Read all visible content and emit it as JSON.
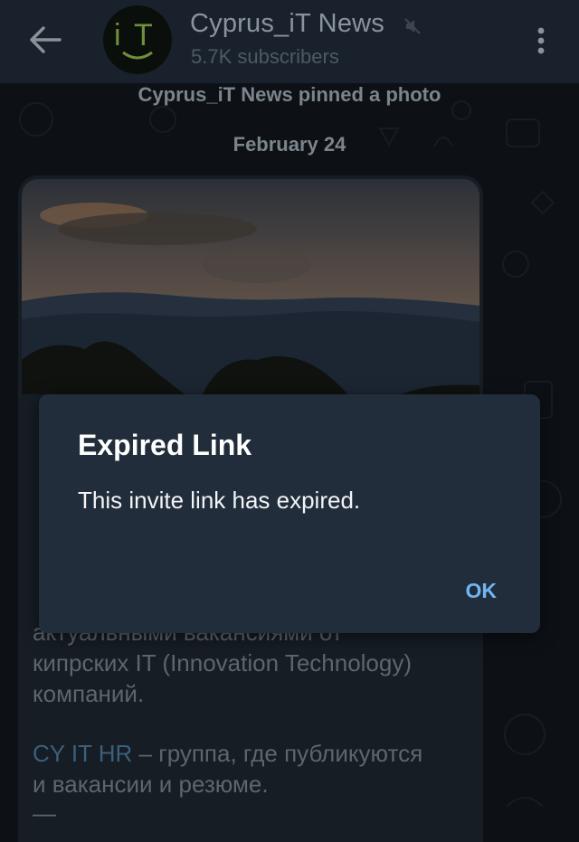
{
  "header": {
    "channel_title": "Cyprus_iT News",
    "subscribers": "5.7K subscribers",
    "avatar_text": "iT"
  },
  "chat": {
    "pinned_notice": "Cyprus_iT News pinned a photo",
    "date_separator": "February 24",
    "message_lines": [
      "актуальными вакансиями от",
      "кипрских IT (Innovation Technology)",
      "компаний."
    ],
    "hr_link": "CY IT HR",
    "hr_text_1": " – группа, где публикуются",
    "hr_text_2": "и вакансии и резюме.",
    "dash": "—"
  },
  "dialog": {
    "title": "Expired Link",
    "message": "This invite link has expired.",
    "ok_label": "OK"
  },
  "colors": {
    "dialog_bg": "#212d3b",
    "ok_accent": "#70b6f3",
    "link": "#3c5f7b"
  },
  "icons": [
    "back-arrow-icon",
    "mute-icon",
    "more-vertical-icon"
  ]
}
